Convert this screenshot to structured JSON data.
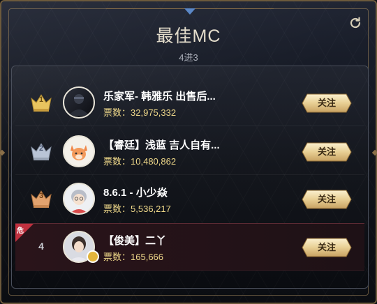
{
  "header": {
    "title": "最佳MC",
    "subtitle": "4进3"
  },
  "labels": {
    "votes_prefix": "票数：",
    "follow": "关注",
    "danger": "危"
  },
  "entries": [
    {
      "rank": 1,
      "name": "乐家军- 韩雅乐 出售后...",
      "votes": "32,975,332",
      "medal": "gold"
    },
    {
      "rank": 2,
      "name": "【睿廷】浅蓝 吉人自有...",
      "votes": "10,480,862",
      "medal": "silver"
    },
    {
      "rank": 3,
      "name": "8.6.1 - 小少焱",
      "votes": "5,536,217",
      "medal": "bronze"
    },
    {
      "rank": 4,
      "name": "【俊美】二丫",
      "votes": "165,666",
      "medal": "none",
      "danger": true
    }
  ],
  "colors": {
    "gold": "#e8c45f",
    "silver": "#b9c4d6",
    "bronze": "#e2a36f",
    "votes_text": "#f0d98a",
    "danger": "#c0313f"
  }
}
